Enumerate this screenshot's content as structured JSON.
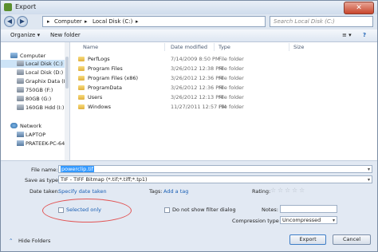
{
  "window": {
    "title": "Export",
    "close_glyph": "✕"
  },
  "address": {
    "back_glyph": "◀",
    "forward_glyph": "▶",
    "crumbs": [
      "Computer",
      "Local Disk (C:)"
    ],
    "separator": "▸",
    "search_placeholder": "Search Local Disk (C:)"
  },
  "toolbar": {
    "organize": "Organize ▾",
    "new_folder": "New folder",
    "views": "≡ ▾",
    "help": "?"
  },
  "nav": {
    "items": [
      {
        "label": "Computer",
        "icon": "computer-icon"
      },
      {
        "label": "Local Disk (C:)",
        "icon": "drive-icon"
      },
      {
        "label": "Local Disk (D:)",
        "icon": "drive-icon"
      },
      {
        "label": "Graphix Data (E:)",
        "icon": "drive-icon"
      },
      {
        "label": "750GB (F:)",
        "icon": "drive-icon"
      },
      {
        "label": "80GB (G:)",
        "icon": "drive-icon"
      },
      {
        "label": "160GB Hdd (I:)",
        "icon": "drive-icon"
      },
      {
        "label": "Network",
        "icon": "network-icon"
      },
      {
        "label": "LAPTOP",
        "icon": "pc-icon"
      },
      {
        "label": "PRATEEK-PC-64",
        "icon": "pc-icon"
      }
    ]
  },
  "files": {
    "columns": [
      "Name",
      "Date modified",
      "Type",
      "Size"
    ],
    "rows": [
      {
        "name": "PerfLogs",
        "date": "7/14/2009 8:50 PM",
        "type": "File folder"
      },
      {
        "name": "Program Files",
        "date": "3/26/2012 12:38 PM",
        "type": "File folder"
      },
      {
        "name": "Program Files (x86)",
        "date": "3/26/2012 12:36 PM",
        "type": "File folder"
      },
      {
        "name": "ProgramData",
        "date": "3/26/2012 12:36 PM",
        "type": "File folder"
      },
      {
        "name": "Users",
        "date": "3/26/2012 12:13 PM",
        "type": "File folder"
      },
      {
        "name": "Windows",
        "date": "11/27/2011 12:57 PM",
        "type": "File folder"
      }
    ]
  },
  "form": {
    "file_name_label": "File name:",
    "file_name_value": "powerclip.tif",
    "save_as_label": "Save as type:",
    "save_as_value": "TIF - TIFF Bitmap (*.tif;*.tiff;*.tp1)",
    "date_taken_label": "Date taken:",
    "date_taken_link": "Specify date taken",
    "tags_label": "Tags:",
    "tags_link": "Add a tag",
    "rating_label": "Rating:",
    "selected_only": "Selected only",
    "no_filter_dialog": "Do not show filter dialog",
    "notes_label": "Notes:",
    "compression_label": "Compression type",
    "compression_value": "Uncompressed",
    "export_button": "Export",
    "cancel_button": "Cancel",
    "hide_folders": "Hide Folders",
    "hide_glyph": "⌃",
    "star_glyph": "☆",
    "arrow_glyph": "▾"
  }
}
